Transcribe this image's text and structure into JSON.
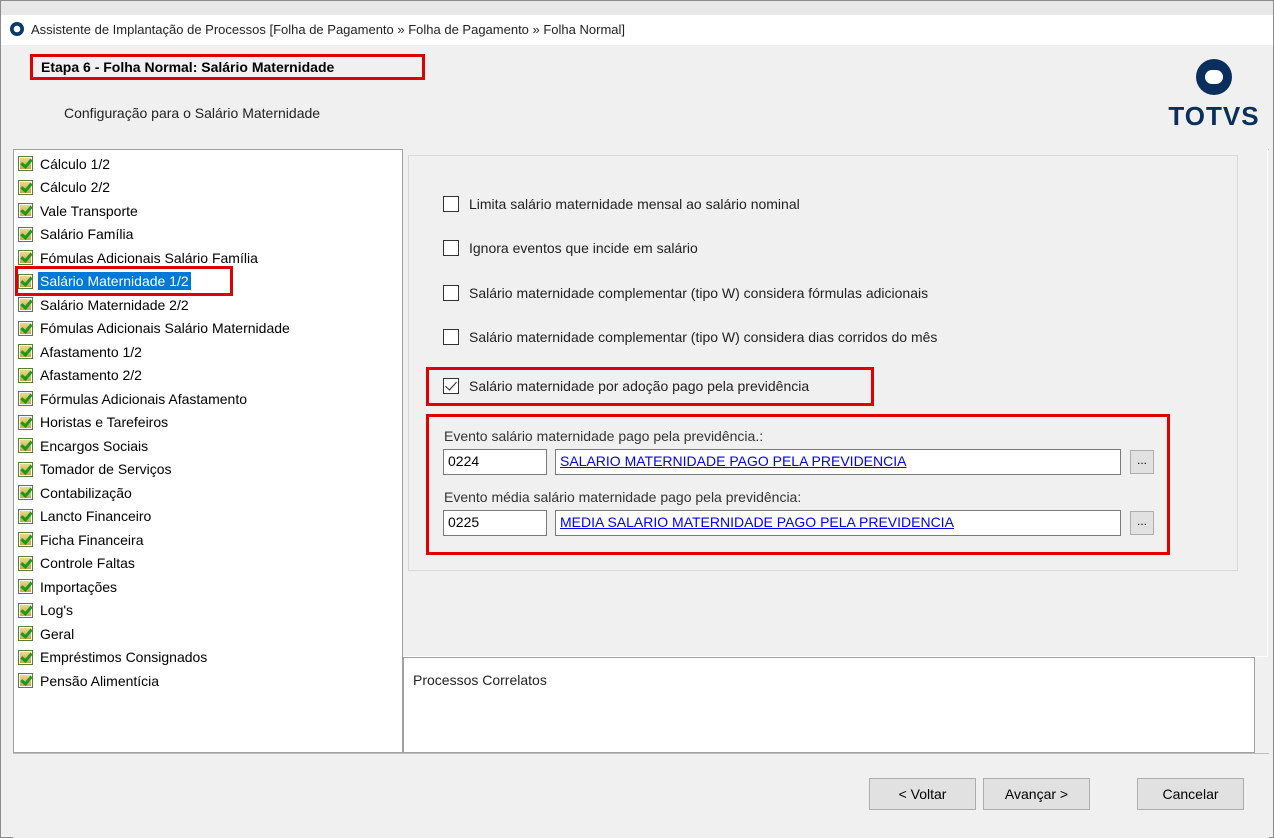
{
  "window": {
    "title": "Assistente de Implantação de Processos [Folha de Pagamento » Folha de Pagamento » Folha Normal]"
  },
  "header": {
    "step_title": "Etapa 6 - Folha Normal: Salário Maternidade",
    "subtitle": "Configuração para o Salário Maternidade",
    "brand": "TOTVS"
  },
  "tree": {
    "items": [
      {
        "label": "Cálculo 1/2"
      },
      {
        "label": "Cálculo 2/2"
      },
      {
        "label": "Vale Transporte"
      },
      {
        "label": "Salário Família"
      },
      {
        "label": "Fómulas Adicionais Salário Família"
      },
      {
        "label": "Salário Maternidade 1/2",
        "selected": true
      },
      {
        "label": "Salário Maternidade 2/2"
      },
      {
        "label": "Fómulas Adicionais Salário Maternidade"
      },
      {
        "label": "Afastamento 1/2"
      },
      {
        "label": "Afastamento 2/2"
      },
      {
        "label": "Fórmulas Adicionais Afastamento"
      },
      {
        "label": "Horistas e Tarefeiros"
      },
      {
        "label": "Encargos Sociais"
      },
      {
        "label": "Tomador de Serviços"
      },
      {
        "label": "Contabilização"
      },
      {
        "label": "Lancto Financeiro"
      },
      {
        "label": "Ficha Financeira"
      },
      {
        "label": "Controle Faltas"
      },
      {
        "label": "Importações"
      },
      {
        "label": "Log's"
      },
      {
        "label": "Geral"
      },
      {
        "label": "Empréstimos Consignados"
      },
      {
        "label": "Pensão Alimentícia"
      }
    ]
  },
  "options": [
    {
      "label": "Limita salário maternidade mensal ao salário nominal",
      "checked": false
    },
    {
      "label": "Ignora eventos que incide em salário",
      "checked": false
    },
    {
      "label": "Salário maternidade complementar (tipo W) considera fórmulas adicionais",
      "checked": false
    },
    {
      "label": "Salário maternidade complementar (tipo W) considera dias corridos do mês",
      "checked": false
    },
    {
      "label": "Salário maternidade por adoção pago pela previdência",
      "checked": true
    }
  ],
  "events": [
    {
      "label": "Evento salário maternidade pago pela previdência.:",
      "code": "0224",
      "description": "SALARIO MATERNIDADE PAGO PELA PREVIDENCIA",
      "lookup": "..."
    },
    {
      "label": "Evento média salário maternidade pago pela previdência:",
      "code": "0225",
      "description": "MEDIA SALARIO MATERNIDADE PAGO PELA PREVIDENCIA",
      "lookup": "..."
    }
  ],
  "related": {
    "title": "Processos Correlatos"
  },
  "footer": {
    "back_label": "< Voltar",
    "next_label": "Avançar >",
    "cancel_label": "Cancelar"
  },
  "colors": {
    "highlight": "#e00000",
    "selection": "#0078d7",
    "link": "#0000ee",
    "brand": "#0a2f5c"
  }
}
